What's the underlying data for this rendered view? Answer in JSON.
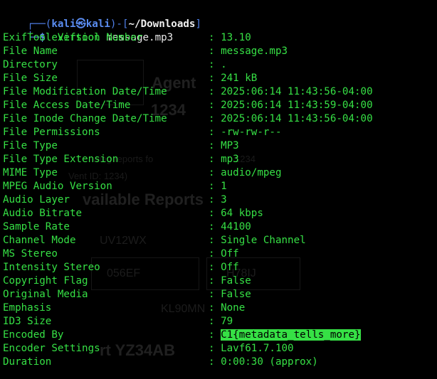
{
  "terminal": {
    "prompt": {
      "corner_top": "┌──(",
      "user": "kali",
      "at_symbol": "㉿",
      "host": "kali",
      "mid": ")-[",
      "path": "~/Downloads",
      "close": "]",
      "corner_bottom": "└─",
      "dollar": "$",
      "command": "exiftool",
      "argument": "message.mp3"
    },
    "separator": ":",
    "rows": [
      {
        "key": "ExifTool Version Number",
        "value": "13.10"
      },
      {
        "key": "File Name",
        "value": "message.mp3"
      },
      {
        "key": "Directory",
        "value": "."
      },
      {
        "key": "File Size",
        "value": "241 kB"
      },
      {
        "key": "File Modification Date/Time",
        "value": "2025:06:14 11:43:56-04:00"
      },
      {
        "key": "File Access Date/Time",
        "value": "2025:06:14 11:43:59-04:00"
      },
      {
        "key": "File Inode Change Date/Time",
        "value": "2025:06:14 11:43:56-04:00"
      },
      {
        "key": "File Permissions",
        "value": "-rw-rw-r--"
      },
      {
        "key": "File Type",
        "value": "MP3"
      },
      {
        "key": "File Type Extension",
        "value": "mp3"
      },
      {
        "key": "MIME Type",
        "value": "audio/mpeg"
      },
      {
        "key": "MPEG Audio Version",
        "value": "1"
      },
      {
        "key": "Audio Layer",
        "value": "3"
      },
      {
        "key": "Audio Bitrate",
        "value": "64 kbps"
      },
      {
        "key": "Sample Rate",
        "value": "44100"
      },
      {
        "key": "Channel Mode",
        "value": "Single Channel"
      },
      {
        "key": "MS Stereo",
        "value": "Off"
      },
      {
        "key": "Intensity Stereo",
        "value": "Off"
      },
      {
        "key": "Copyright Flag",
        "value": "False"
      },
      {
        "key": "Original Media",
        "value": "False"
      },
      {
        "key": "Emphasis",
        "value": "None"
      },
      {
        "key": "ID3 Size",
        "value": "79"
      },
      {
        "key": "Encoded By",
        "value": "C1{metadata_tells_more}",
        "highlighted": true
      },
      {
        "key": "Encoder Settings",
        "value": "Lavf61.7.100"
      },
      {
        "key": "Duration",
        "value": "0:00:30 (approx)"
      }
    ]
  },
  "background": {
    "texts": [
      "Agent",
      "1234",
      "wing reports fo",
      "1234",
      "Vent ID: 1234)",
      "vailable Reports",
      "UV12WX",
      "056EF",
      "H78IJ",
      "KL90MN",
      "rt YZ34AB"
    ]
  },
  "colors": {
    "background": "#000000",
    "output_green": "#36e045",
    "prompt_blue": "#4f7fe8",
    "text_white": "#e8e8e8"
  }
}
